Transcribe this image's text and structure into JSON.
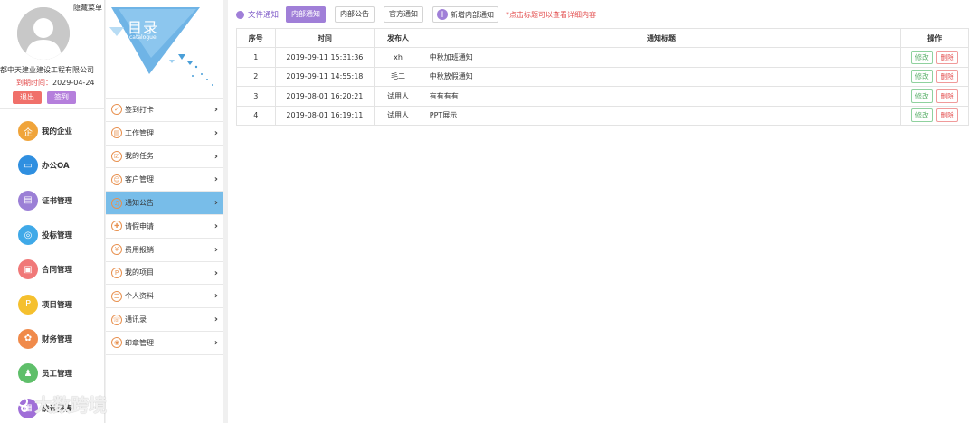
{
  "sidebar": {
    "hide_menu": "隐藏菜单",
    "company": "都中天建业建设工程有限公司",
    "expire_label": "到期时间：",
    "expire_date": "2029-04-24",
    "logout": "退出",
    "sign": "签到",
    "items": [
      {
        "label": "我的企业",
        "icon": "enterprise-icon",
        "color": "#f0a43a",
        "glyph": "企"
      },
      {
        "label": "办公OA",
        "icon": "monitor-icon",
        "color": "#2f8fe0",
        "glyph": "▭"
      },
      {
        "label": "证书管理",
        "icon": "certificate-icon",
        "color": "#9b7fd6",
        "glyph": "▤"
      },
      {
        "label": "投标管理",
        "icon": "target-icon",
        "color": "#3fa9e8",
        "glyph": "◎"
      },
      {
        "label": "合同管理",
        "icon": "briefcase-icon",
        "color": "#f07878",
        "glyph": "▣"
      },
      {
        "label": "项目管理",
        "icon": "project-icon",
        "color": "#f5c02e",
        "glyph": "P"
      },
      {
        "label": "财务管理",
        "icon": "finance-icon",
        "color": "#f08a4a",
        "glyph": "✿"
      },
      {
        "label": "员工管理",
        "icon": "staff-icon",
        "color": "#5fbf6a",
        "glyph": "♟"
      },
      {
        "label": "统计报表",
        "icon": "report-icon",
        "color": "#a06fd8",
        "glyph": "▦"
      }
    ]
  },
  "catalog": {
    "title": "目录",
    "subtitle": "catalogue"
  },
  "submenu": {
    "items": [
      {
        "label": "签到打卡",
        "icon": "checkin-icon",
        "active": false
      },
      {
        "label": "工作管理",
        "icon": "work-icon",
        "active": false
      },
      {
        "label": "我的任务",
        "icon": "task-icon",
        "active": false
      },
      {
        "label": "客户管理",
        "icon": "customer-icon",
        "active": false
      },
      {
        "label": "通知公告",
        "icon": "bell-icon",
        "active": true
      },
      {
        "label": "请假申请",
        "icon": "leave-icon",
        "active": false
      },
      {
        "label": "费用报销",
        "icon": "expense-icon",
        "active": false
      },
      {
        "label": "我的项目",
        "icon": "project-p-icon",
        "active": false
      },
      {
        "label": "个人资料",
        "icon": "profile-icon",
        "active": false
      },
      {
        "label": "通讯录",
        "icon": "contacts-icon",
        "active": false
      },
      {
        "label": "印章管理",
        "icon": "seal-icon",
        "active": false
      }
    ]
  },
  "toolbar": {
    "file_notice": "文件通知",
    "tabs": [
      "内部通知",
      "内部公告",
      "官方通知"
    ],
    "active_tab": 0,
    "add_label": "新增内部通知",
    "hint": "*点击标题可以查看详细内容"
  },
  "table": {
    "headers": [
      "序号",
      "时间",
      "发布人",
      "通知标题",
      "操作"
    ],
    "rows": [
      {
        "no": "1",
        "time": "2019-09-11 15:31:36",
        "publisher": "xh",
        "title": "中秋加班通知"
      },
      {
        "no": "2",
        "time": "2019-09-11 14:55:18",
        "publisher": "毛二",
        "title": "中秋放假通知"
      },
      {
        "no": "3",
        "time": "2019-08-01 16:20:21",
        "publisher": "试用人",
        "title": "有有有有"
      },
      {
        "no": "4",
        "time": "2019-08-01 16:19:11",
        "publisher": "试用人",
        "title": "PPT展示"
      }
    ],
    "edit_label": "修改",
    "delete_label": "删除"
  },
  "watermark": "大数跨境"
}
